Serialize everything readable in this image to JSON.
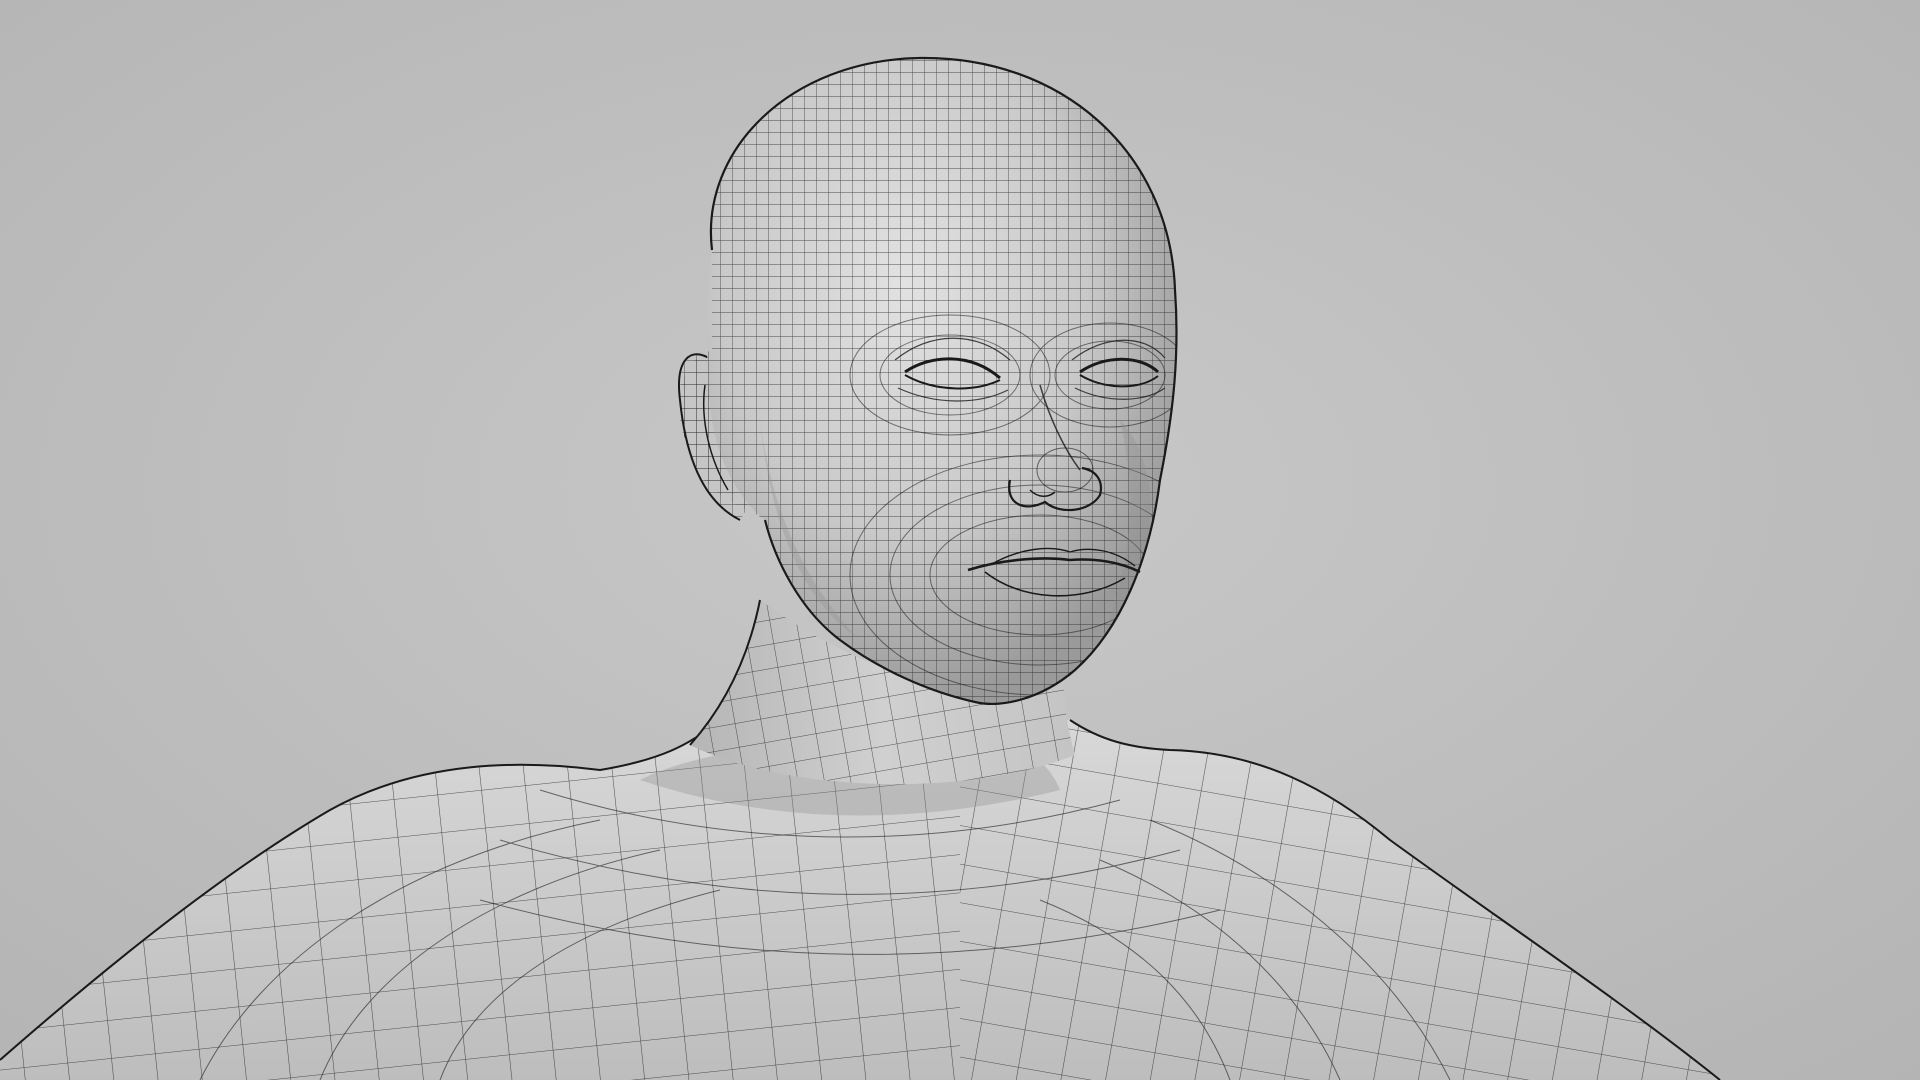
{
  "scene": {
    "subject": "wireframe-head-and-shoulders",
    "colors": {
      "background": "#bebebe",
      "surface_light": "#d6d6d6",
      "surface_mid": "#b8b8b8",
      "surface_shadow": "#8e8e8e",
      "wire": "#1a1a1a"
    },
    "eyes": "closed",
    "shading": "smooth-with-wireframe-overlay"
  }
}
